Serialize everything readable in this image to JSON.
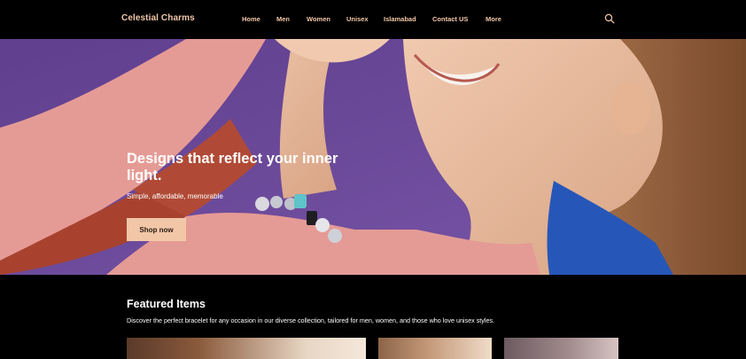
{
  "header": {
    "brand": "Celestial Charms",
    "nav": [
      {
        "label": "Home"
      },
      {
        "label": "Men"
      },
      {
        "label": "Women"
      },
      {
        "label": "Unisex"
      },
      {
        "label": "Islamabad"
      },
      {
        "label": "Contact US"
      },
      {
        "label": "More"
      }
    ],
    "search_icon": "search-icon"
  },
  "hero": {
    "title": "Designs that reflect your inner light.",
    "subtitle": "Simple, affordable, memorable",
    "cta_label": "Shop now"
  },
  "featured": {
    "title": "Featured Items",
    "description": "Discover the perfect bracelet for any occasion in our diverse collection, tailored for men, women, and those who love unisex styles."
  },
  "colors": {
    "accent": "#f2c7a8",
    "background": "#000000",
    "hero_background": "#6b4a97"
  }
}
